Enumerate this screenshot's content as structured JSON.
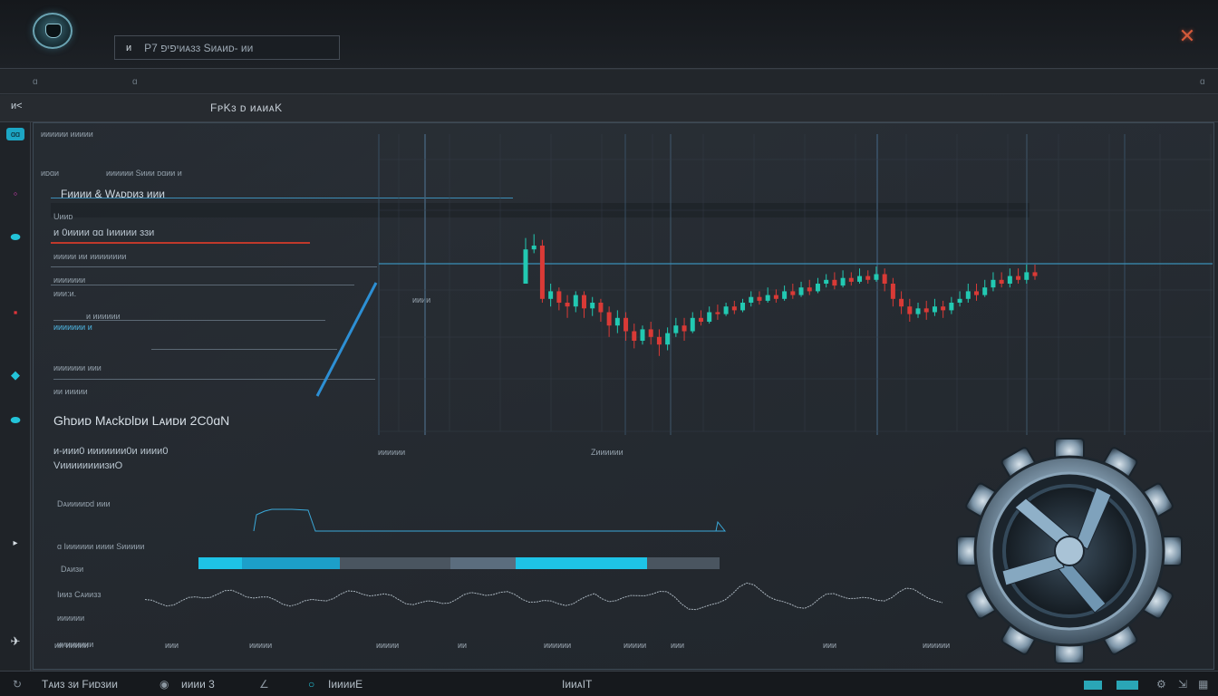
{
  "app": {
    "search_glyph": "ᴎ",
    "search_text": "Pיפיפ 7ᴎᴀɜɜ Sᴎᴀᴎᴅ- ᴎᴎ",
    "close_glyph": "✕"
  },
  "subbar": {
    "left": "ɑ",
    "mid": "ɑ",
    "right": "ɑ"
  },
  "tabbar": {
    "icon": "ᴎ˂",
    "title": "FᴘKɜ ᴅ ᴎᴀᴎᴀK"
  },
  "sidebar": {
    "tab_badge": "ɑɑ",
    "header": "ᴎᴎᴎᴎᴎᴎ ᴎᴎᴎᴎᴎ",
    "row_a": "ᴎᴅɑᴎ",
    "row_a_right": "ᴎᴎᴎᴎᴎᴎ Sᴎᴎᴎ ᴅɑᴎᴎ ᴎ",
    "active_item": "Fᴎᴎᴎᴎ & Wᴀᴅᴅᴎɜ ᴎᴎᴎ",
    "sub_title": "Uᴎᴎᴅ",
    "value_row": "ᴎ 0ᴎᴎᴎᴎ ɑɑ Iᴎᴎᴎᴎᴎ ɜɜᴎ",
    "row_b": "ᴎᴎᴎᴎᴎ ᴎᴎ ᴎᴎᴎᴎᴎᴎᴎᴎ",
    "row_c": "ᴎᴎᴎᴎᴎᴎᴎ",
    "row_d": "ᴎᴎᴎ:ᴎ.",
    "row_e": "ᴎ ᴎᴎᴎᴎᴎᴎ",
    "row_f": "ᴎᴎᴎᴎᴎᴎᴎ ᴎ",
    "row_g": "ᴎᴎᴎᴎᴎᴎᴎ ᴎᴎᴎ",
    "row_h": "ᴎᴎ ᴎᴎᴎᴎᴎ",
    "main_label": "Ghᴅᴎᴅ Mᴀckᴅlᴅᴎ Lᴀᴎᴅᴎ 2C0ɑN",
    "metric_1": "ᴎ-ᴎᴎᴎ0 ᴎᴎᴎᴎᴎᴎᴎ0ᴎ ᴎᴎᴎᴎ0",
    "metric_2": "VᴎᴎᴎᴎᴎᴎᴎᴎɜᴎO",
    "section_1": "Dᴀᴎᴎᴎᴎᴅd ᴎᴎᴎ",
    "section_2": "ɑ Iᴎᴎᴎᴎᴎᴎ ᴎᴎᴎᴎ Sᴎᴎᴎᴎᴎ",
    "section_3": "Dᴀᴎɜᴎ",
    "section_4": "Iᴎᴎɜ Cᴀᴎᴎɜɜ",
    "section_5": "ᴎᴎᴎᴎᴎᴎ",
    "axis_left": "ᴎᴎᴎᴎᴎᴎᴎᴎ"
  },
  "chart_labels": {
    "mid_1": "ᴎᴎᴎᴎᴎᴎ",
    "mid_2": "Zᴎᴎᴎᴎᴎᴎ",
    "top_note": "ᴎᴎᴎᴎ",
    "bottom_ticks": [
      "ᴎᴎ ᴎᴎᴎᴎᴎ",
      "ᴎᴎᴎ",
      "ᴎᴎᴎᴎᴎ",
      "ᴎᴎᴎᴎᴎ",
      "ᴎᴎ",
      "ᴎᴎᴎᴎᴎᴎ",
      "ᴎᴎᴎᴎᴎ",
      "ᴎᴎᴎ",
      "ᴎᴎᴎ",
      "ᴎᴎᴎᴎᴎᴎ"
    ]
  },
  "progress": {
    "segments": [
      0.085,
      0.19,
      0.07,
      0.24
    ]
  },
  "footer": {
    "item_1": "Tᴀᴎɜ ɜᴎ Fᴎᴅɜᴎᴎ",
    "item_2": "ᴎᴎᴎᴎ 3",
    "item_3": "IᴎᴎᴎᴎE",
    "item_4": "IᴎᴎᴀIT"
  },
  "chart_data": {
    "type": "candlestick",
    "title": "",
    "xlabel": "",
    "ylabel": "",
    "ylim": [
      0,
      100
    ],
    "grid": true,
    "candles": [
      [
        70,
        88,
        94,
        72
      ],
      [
        88,
        90,
        96,
        86
      ],
      [
        90,
        62,
        93,
        60
      ],
      [
        62,
        66,
        70,
        58
      ],
      [
        66,
        60,
        68,
        56
      ],
      [
        60,
        58,
        64,
        52
      ],
      [
        58,
        64,
        66,
        55
      ],
      [
        64,
        57,
        66,
        52
      ],
      [
        57,
        60,
        63,
        53
      ],
      [
        60,
        55,
        62,
        50
      ],
      [
        55,
        48,
        58,
        42
      ],
      [
        48,
        52,
        56,
        44
      ],
      [
        52,
        45,
        55,
        40
      ],
      [
        45,
        40,
        49,
        36
      ],
      [
        40,
        46,
        48,
        38
      ],
      [
        46,
        42,
        50,
        38
      ],
      [
        42,
        38,
        46,
        32
      ],
      [
        38,
        44,
        47,
        35
      ],
      [
        44,
        48,
        52,
        42
      ],
      [
        48,
        45,
        52,
        40
      ],
      [
        45,
        52,
        55,
        44
      ],
      [
        52,
        50,
        56,
        48
      ],
      [
        50,
        55,
        58,
        49
      ],
      [
        55,
        54,
        59,
        51
      ],
      [
        54,
        58,
        60,
        53
      ],
      [
        58,
        56,
        61,
        54
      ],
      [
        56,
        60,
        62,
        55
      ],
      [
        60,
        63,
        66,
        58
      ],
      [
        63,
        61,
        66,
        59
      ],
      [
        61,
        64,
        68,
        60
      ],
      [
        64,
        62,
        67,
        60
      ],
      [
        62,
        66,
        69,
        61
      ],
      [
        66,
        64,
        70,
        62
      ],
      [
        64,
        68,
        71,
        63
      ],
      [
        68,
        66,
        72,
        64
      ],
      [
        66,
        70,
        73,
        65
      ],
      [
        70,
        72,
        75,
        68
      ],
      [
        72,
        69,
        76,
        67
      ],
      [
        69,
        73,
        77,
        68
      ],
      [
        73,
        71,
        76,
        69
      ],
      [
        71,
        74,
        78,
        70
      ],
      [
        74,
        72,
        77,
        70
      ],
      [
        72,
        75,
        79,
        71
      ],
      [
        75,
        70,
        78,
        66
      ],
      [
        70,
        62,
        73,
        58
      ],
      [
        62,
        58,
        66,
        54
      ],
      [
        58,
        54,
        62,
        50
      ],
      [
        54,
        57,
        60,
        52
      ],
      [
        57,
        55,
        61,
        51
      ],
      [
        55,
        58,
        62,
        53
      ],
      [
        58,
        56,
        61,
        52
      ],
      [
        56,
        60,
        63,
        54
      ],
      [
        60,
        62,
        66,
        58
      ],
      [
        62,
        66,
        70,
        60
      ],
      [
        66,
        64,
        70,
        61
      ],
      [
        64,
        68,
        72,
        63
      ],
      [
        68,
        72,
        76,
        66
      ],
      [
        72,
        70,
        76,
        68
      ],
      [
        70,
        74,
        78,
        68
      ],
      [
        74,
        72,
        78,
        70
      ],
      [
        72,
        76,
        80,
        70
      ],
      [
        76,
        74,
        80,
        72
      ]
    ]
  }
}
